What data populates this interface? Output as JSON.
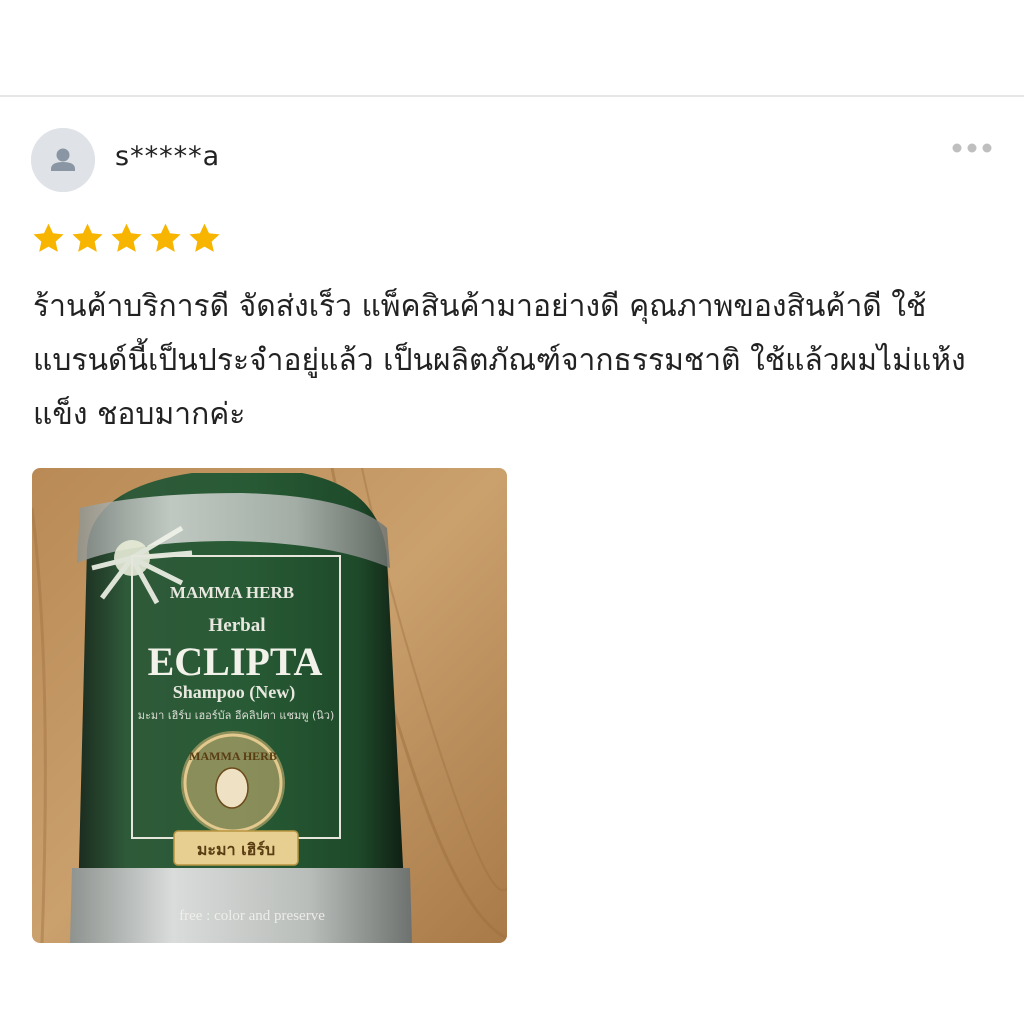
{
  "review": {
    "username": "s*****a",
    "rating": 5,
    "max_rating": 5,
    "text": "ร้านค้าบริการดี จัดส่งเร็ว แพ็คสินค้ามาอย่างดี คุณภาพของสินค้าดี ใช้แบรนด์นี้เป็นประจำอยู่แล้ว เป็นผลิตภัณฑ์จากธรรมชาติ ใช้แล้วผมไม่แห้งแข็ง ชอบมากค่ะ",
    "icons": {
      "avatar": "user-icon",
      "more": "more-horizontal-icon",
      "star": "star-icon"
    },
    "colors": {
      "star": "#f7b500",
      "avatar_bg": "#dfe3e8",
      "avatar_fg": "#8a96a3",
      "more": "#bfbfbf"
    },
    "photo": {
      "label": {
        "brand": "MAMMA HERB",
        "line1": "Herbal",
        "product": "ECLIPTA",
        "line2": "Shampoo (New)",
        "thai": "มะมา เฮิร์บ เฮอร์บัล อีคลิปตา แชมพู (นิว)",
        "logo_text": "MAMMA HERB",
        "logo_thai": "มะมา เฮิร์บ",
        "bottom_text": "free : color and preserve"
      }
    }
  }
}
